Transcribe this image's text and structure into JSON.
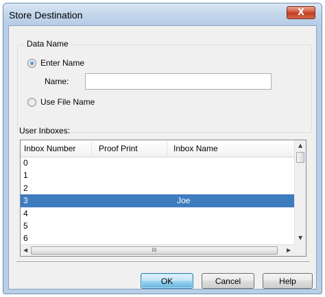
{
  "window": {
    "title": "Store Destination",
    "close_glyph": "X"
  },
  "data_name": {
    "legend": "Data Name",
    "option_enter": "Enter Name",
    "option_use_file": "Use File Name",
    "name_label": "Name:",
    "name_value": "",
    "selected_option": "Enter Name"
  },
  "inboxes": {
    "label": "User Inboxes:",
    "columns": [
      "Inbox Number",
      "Proof Print",
      "Inbox Name"
    ],
    "rows": [
      {
        "number": "0",
        "proof": "",
        "name": ""
      },
      {
        "number": "1",
        "proof": "",
        "name": ""
      },
      {
        "number": "2",
        "proof": "",
        "name": ""
      },
      {
        "number": "3",
        "proof": "",
        "name": "Joe"
      },
      {
        "number": "4",
        "proof": "",
        "name": ""
      },
      {
        "number": "5",
        "proof": "",
        "name": ""
      },
      {
        "number": "6",
        "proof": "",
        "name": ""
      }
    ],
    "selected_index": 3,
    "hthumb_glyph": "III"
  },
  "buttons": {
    "ok": "OK",
    "cancel": "Cancel",
    "help": "Help"
  },
  "colors": {
    "selection": "#3f7cbf",
    "title_close": "#c23b22"
  }
}
